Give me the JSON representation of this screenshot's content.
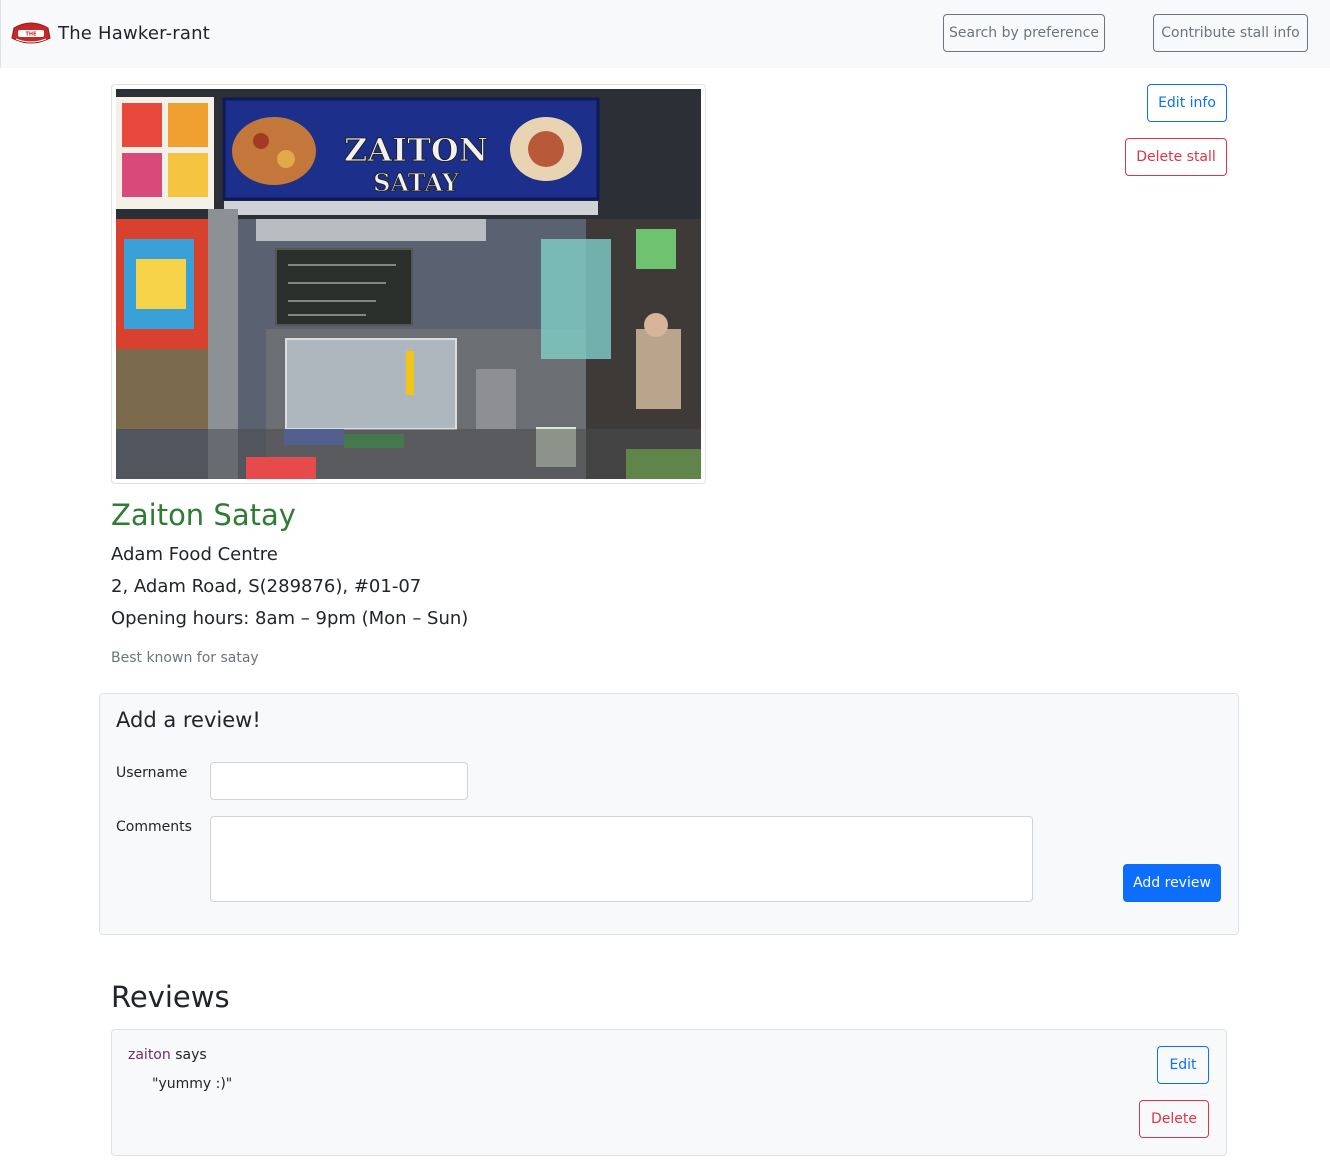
{
  "navbar": {
    "brand_text": "The Hawker-rant",
    "logo_text": "THE",
    "search_label": "Search by preference",
    "contribute_label": "Contribute stall info"
  },
  "stall": {
    "photo_sign_line1": "ZAITON",
    "photo_sign_line2": "SATAY",
    "name": "Zaiton Satay",
    "centre": "Adam Food Centre",
    "address": "2, Adam Road, S(289876), #01-07",
    "hours": "Opening hours: 8am – 9pm (Mon – Sun)",
    "note": "Best known for satay",
    "edit_label": "Edit info",
    "delete_label": "Delete stall"
  },
  "review_form": {
    "title": "Add a review!",
    "username_label": "Username",
    "username_value": "",
    "comments_label": "Comments",
    "comments_value": "",
    "submit_label": "Add review"
  },
  "reviews": {
    "heading": "Reviews",
    "items": [
      {
        "username": "zaiton",
        "says": "says",
        "text": "\"yummy :)\"",
        "edit_label": "Edit",
        "delete_label": "Delete"
      }
    ]
  },
  "colors": {
    "stall_name": "#2e7d32",
    "primary": "#0d6efd",
    "danger": "#dc3545",
    "secondary": "#6c757d",
    "reviewer_name": "#6f2c6f"
  },
  "icons": {
    "logo": "hawker-rant-logo-icon"
  }
}
